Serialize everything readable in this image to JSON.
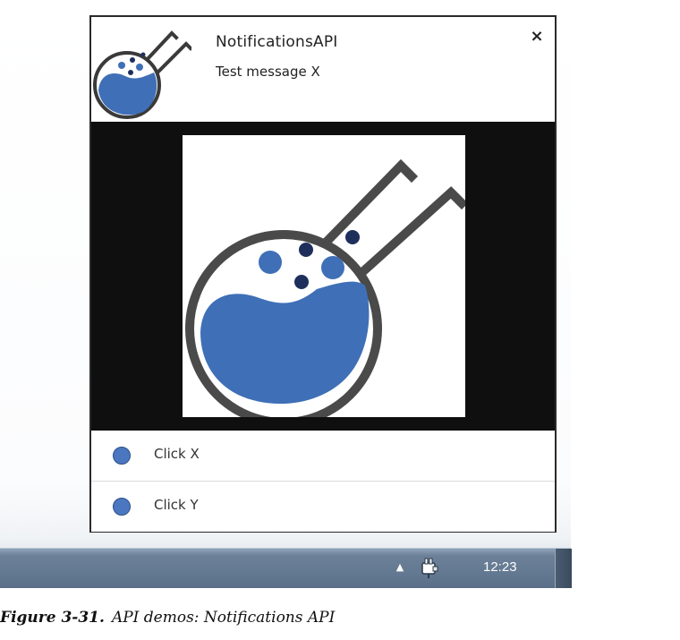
{
  "notification": {
    "title": "NotificationsAPI",
    "message": "Test message X",
    "close_symbol": "×",
    "icon": "flask-logo-icon",
    "image": "flask-logo-large",
    "buttons": [
      {
        "label": "Click X",
        "icon": "blue-circle-icon"
      },
      {
        "label": "Click Y",
        "icon": "blue-circle-icon"
      }
    ]
  },
  "taskbar": {
    "clock": "12:23",
    "tray_arrow_symbol": "▲",
    "tray_icons": [
      "show-hidden-icons-arrow",
      "power-plug-icon"
    ]
  },
  "caption": {
    "number": "Figure 3-31.",
    "text": "API demos: Notifications API"
  },
  "colors": {
    "flask_blue": "#3f6fb7",
    "flask_dark_dot": "#1f2f5c",
    "flask_outline": "#4a4a4a",
    "image_background": "#0f0f0f",
    "taskbar": "#627790"
  }
}
